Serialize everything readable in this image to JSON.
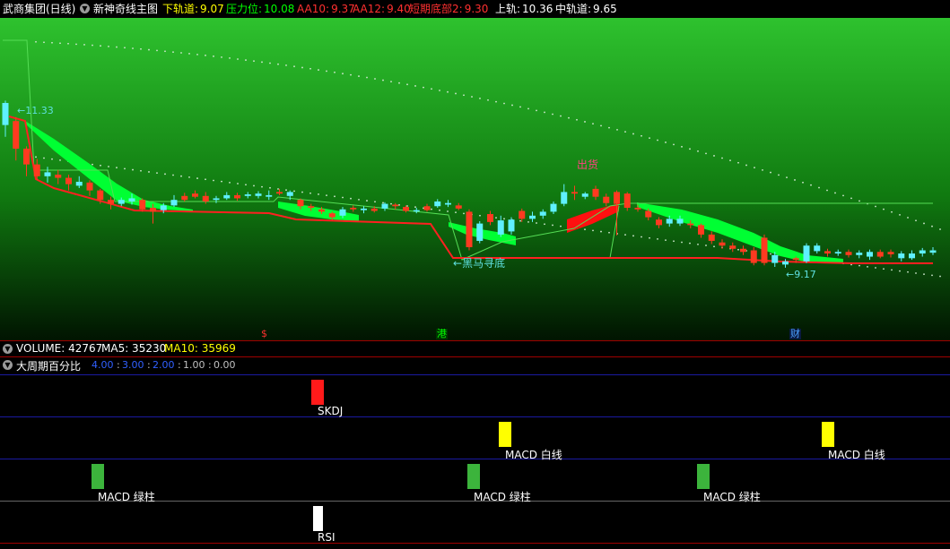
{
  "header": {
    "stock": "武商集团(日线)",
    "indicator_name": "新神奇线主图",
    "items": [
      {
        "label": "下轨道:",
        "value": "9.07",
        "color": "#ffff00"
      },
      {
        "label": "压力位:",
        "value": "10.08",
        "color": "#00ff00"
      },
      {
        "label": "AA10:",
        "value": "9.37",
        "color": "#ff3030"
      },
      {
        "label": "AA12:",
        "value": "9.40",
        "color": "#ff3030"
      },
      {
        "label": "短期底部2:",
        "value": "9.30",
        "color": "#ff3030"
      },
      {
        "label": "上轨:",
        "value": "10.36",
        "color": "#ffffff"
      },
      {
        "label": "中轨道:",
        "value": "9.65",
        "color": "#ffffff"
      }
    ]
  },
  "main_chart": {
    "high_label": "11.33",
    "low_label": "9.17",
    "sell_label": "出货",
    "dark_horse_label": "黑马寻底",
    "markers": [
      {
        "text": "$",
        "color": "#ff3030"
      },
      {
        "text": "港",
        "color": "#00ff00"
      },
      {
        "text": "财",
        "color": "#4aa0ff"
      }
    ]
  },
  "volume_panel": {
    "title": "VOLUME: 42767",
    "ma5": "MA5: 35230",
    "ma10": "MA10: 35969"
  },
  "percent_panel": {
    "title": "大周期百分比",
    "scale": [
      {
        "text": "4.00",
        "color": "#3060ff"
      },
      {
        "text": "3.00",
        "color": "#3060ff"
      },
      {
        "text": "2.00",
        "color": "#3060ff"
      },
      {
        "text": "1.00",
        "color": "#c0c0c0"
      },
      {
        "text": "0.00",
        "color": "#c0c0c0"
      }
    ],
    "signals": [
      {
        "label": "SKDJ",
        "color": "#ff1a1a"
      },
      {
        "label": "MACD 白线",
        "color": "#ffff00"
      },
      {
        "label": "MACD 白线",
        "color": "#ffff00"
      },
      {
        "label": "MACD 绿柱",
        "color": "#3cb43c"
      },
      {
        "label": "MACD 绿柱",
        "color": "#3cb43c"
      },
      {
        "label": "MACD 绿柱",
        "color": "#3cb43c"
      },
      {
        "label": "RSI",
        "color": "#ffffff"
      }
    ]
  },
  "chart_data": {
    "type": "candlestick",
    "y_range": [
      9.0,
      11.5
    ],
    "candles": [
      [
        11.05,
        11.33,
        11.36,
        10.9,
        "up"
      ],
      [
        11.1,
        10.75,
        11.15,
        10.6,
        "down"
      ],
      [
        10.75,
        10.55,
        10.78,
        10.4,
        "down"
      ],
      [
        10.55,
        10.4,
        10.62,
        10.35,
        "down"
      ],
      [
        10.4,
        10.45,
        10.52,
        10.32,
        "up"
      ],
      [
        10.42,
        10.38,
        10.48,
        10.3,
        "down"
      ],
      [
        10.38,
        10.3,
        10.42,
        10.22,
        "down"
      ],
      [
        10.28,
        10.33,
        10.4,
        10.25,
        "up"
      ],
      [
        10.32,
        10.22,
        10.35,
        10.15,
        "down"
      ],
      [
        10.22,
        10.1,
        10.24,
        10.05,
        "down"
      ],
      [
        10.1,
        10.05,
        10.14,
        9.98,
        "down"
      ],
      [
        10.05,
        10.1,
        10.13,
        10.02,
        "up"
      ],
      [
        10.12,
        10.08,
        10.18,
        10.04,
        "up"
      ],
      [
        10.1,
        9.98,
        10.12,
        9.95,
        "down"
      ],
      [
        10.0,
        9.95,
        10.05,
        9.8,
        "down"
      ],
      [
        9.97,
        10.03,
        10.06,
        9.93,
        "up"
      ],
      [
        10.03,
        10.1,
        10.16,
        10.01,
        "up"
      ],
      [
        10.1,
        10.15,
        10.19,
        10.08,
        "down"
      ],
      [
        10.14,
        10.18,
        10.22,
        10.12,
        "down"
      ],
      [
        10.15,
        10.08,
        10.2,
        10.05,
        "down"
      ],
      [
        10.1,
        10.12,
        10.15,
        10.06,
        "up"
      ],
      [
        10.12,
        10.16,
        10.2,
        10.1,
        "up"
      ],
      [
        10.16,
        10.12,
        10.19,
        10.09,
        "down"
      ],
      [
        10.15,
        10.17,
        10.2,
        10.12,
        "up"
      ],
      [
        10.18,
        10.15,
        10.21,
        10.12,
        "up"
      ],
      [
        10.16,
        10.14,
        10.22,
        10.1,
        "up"
      ],
      [
        10.18,
        10.2,
        10.24,
        10.16,
        "down"
      ],
      [
        10.2,
        10.15,
        10.22,
        10.1,
        "up"
      ],
      [
        10.1,
        10.02,
        10.12,
        9.98,
        "down"
      ],
      [
        10.02,
        10.0,
        10.05,
        9.96,
        "down"
      ],
      [
        9.98,
        9.95,
        10.01,
        9.92,
        "down"
      ],
      [
        9.93,
        9.88,
        9.95,
        9.84,
        "down"
      ],
      [
        9.9,
        9.98,
        10.01,
        9.87,
        "up"
      ],
      [
        9.98,
        10.0,
        10.03,
        9.95,
        "down"
      ],
      [
        9.99,
        9.97,
        10.02,
        9.93,
        "up"
      ],
      [
        9.96,
        9.99,
        10.02,
        9.94,
        "down"
      ],
      [
        9.99,
        10.05,
        10.07,
        9.96,
        "up"
      ],
      [
        10.04,
        10.02,
        10.06,
        9.98,
        "down"
      ],
      [
        10.01,
        9.96,
        10.03,
        9.94,
        "down"
      ],
      [
        9.96,
        9.97,
        10.0,
        9.93,
        "up"
      ],
      [
        9.97,
        10.02,
        10.05,
        9.95,
        "down"
      ],
      [
        10.02,
        10.08,
        10.11,
        10.0,
        "up"
      ],
      [
        10.06,
        10.04,
        10.1,
        10.01,
        "up"
      ],
      [
        10.03,
        9.99,
        10.06,
        9.97,
        "down"
      ],
      [
        9.95,
        9.5,
        9.98,
        9.46,
        "down"
      ],
      [
        9.58,
        9.8,
        9.83,
        9.55,
        "up"
      ],
      [
        9.82,
        9.92,
        9.96,
        9.78,
        "down"
      ],
      [
        9.84,
        9.66,
        9.9,
        9.63,
        "up"
      ],
      [
        9.7,
        9.85,
        9.88,
        9.66,
        "up"
      ],
      [
        9.86,
        9.96,
        9.99,
        9.82,
        "down"
      ],
      [
        9.9,
        9.86,
        9.95,
        9.82,
        "up"
      ],
      [
        9.9,
        9.95,
        9.98,
        9.86,
        "up"
      ],
      [
        9.95,
        10.05,
        10.08,
        9.92,
        "up"
      ],
      [
        10.05,
        10.2,
        10.3,
        10.02,
        "up"
      ],
      [
        10.2,
        10.18,
        10.28,
        10.1,
        "down"
      ],
      [
        10.18,
        10.14,
        10.2,
        10.11,
        "up"
      ],
      [
        10.14,
        10.24,
        10.28,
        10.1,
        "down"
      ],
      [
        10.14,
        10.06,
        10.18,
        10.02,
        "down"
      ],
      [
        10.05,
        10.2,
        10.22,
        9.65,
        "down"
      ],
      [
        10.18,
        10.0,
        10.2,
        9.96,
        "down"
      ],
      [
        10.0,
        9.98,
        10.04,
        9.95,
        "down"
      ],
      [
        9.96,
        9.88,
        9.99,
        9.84,
        "down"
      ],
      [
        9.85,
        9.78,
        9.88,
        9.74,
        "down"
      ],
      [
        9.8,
        9.86,
        9.9,
        9.76,
        "up"
      ],
      [
        9.86,
        9.8,
        9.9,
        9.77,
        "up"
      ],
      [
        9.8,
        9.78,
        9.84,
        9.74,
        "down"
      ],
      [
        9.78,
        9.66,
        9.8,
        9.62,
        "down"
      ],
      [
        9.66,
        9.58,
        9.7,
        9.54,
        "down"
      ],
      [
        9.56,
        9.52,
        9.6,
        9.48,
        "down"
      ],
      [
        9.52,
        9.48,
        9.56,
        9.44,
        "down"
      ],
      [
        9.48,
        9.44,
        9.52,
        9.4,
        "down"
      ],
      [
        9.46,
        9.3,
        9.5,
        9.27,
        "down"
      ],
      [
        9.3,
        9.62,
        9.66,
        9.27,
        "down"
      ],
      [
        9.4,
        9.3,
        9.44,
        9.25,
        "up"
      ],
      [
        9.28,
        9.32,
        9.35,
        9.24,
        "up"
      ],
      [
        9.34,
        9.36,
        9.38,
        9.3,
        "down"
      ],
      [
        9.32,
        9.52,
        9.55,
        9.3,
        "up"
      ],
      [
        9.52,
        9.45,
        9.55,
        9.42,
        "up"
      ],
      [
        9.45,
        9.42,
        9.48,
        9.38,
        "down"
      ],
      [
        9.42,
        9.44,
        9.47,
        9.39,
        "up"
      ],
      [
        9.44,
        9.4,
        9.47,
        9.37,
        "down"
      ],
      [
        9.4,
        9.43,
        9.46,
        9.36,
        "up"
      ],
      [
        9.44,
        9.38,
        9.47,
        9.34,
        "up"
      ],
      [
        9.38,
        9.44,
        9.47,
        9.36,
        "down"
      ],
      [
        9.44,
        9.41,
        9.47,
        9.37,
        "down"
      ],
      [
        9.42,
        9.36,
        9.45,
        9.32,
        "up"
      ],
      [
        9.36,
        9.42,
        9.46,
        9.34,
        "up"
      ],
      [
        9.42,
        9.46,
        9.49,
        9.38,
        "up"
      ],
      [
        9.46,
        9.43,
        9.5,
        9.4,
        "up"
      ]
    ]
  }
}
